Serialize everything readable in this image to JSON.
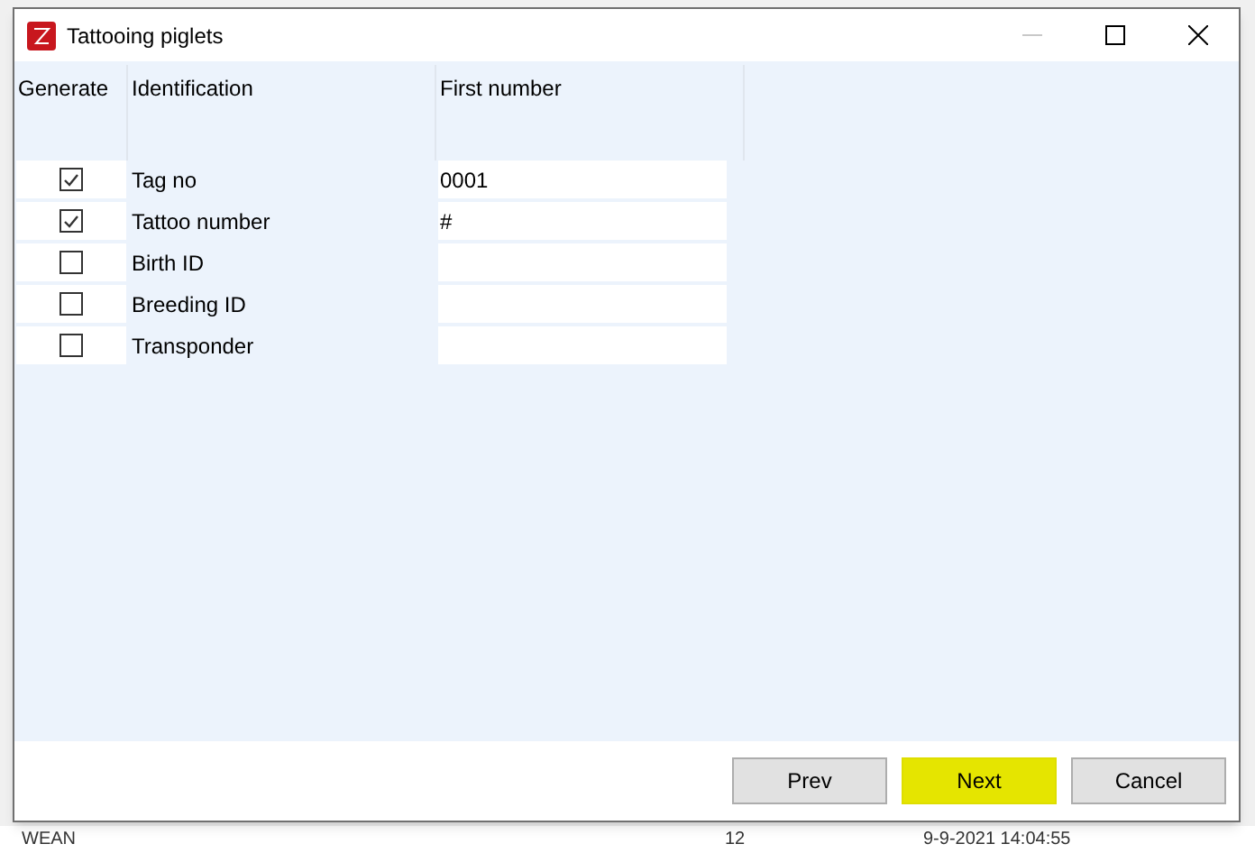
{
  "window": {
    "title": "Tattooing piglets",
    "controls": [
      {
        "kind": "minimize",
        "disabled": true
      },
      {
        "kind": "maximize",
        "disabled": false
      },
      {
        "kind": "close",
        "disabled": false
      }
    ]
  },
  "table": {
    "columns": [
      "Generate",
      "Identification",
      "First number"
    ],
    "rows": [
      {
        "checked": true,
        "identification": "Tag no",
        "first_number": "0001"
      },
      {
        "checked": true,
        "identification": "Tattoo number",
        "first_number": "#"
      },
      {
        "checked": false,
        "identification": "Birth ID",
        "first_number": ""
      },
      {
        "checked": false,
        "identification": "Breeding ID",
        "first_number": ""
      },
      {
        "checked": false,
        "identification": "Transponder",
        "first_number": ""
      }
    ]
  },
  "buttons": [
    {
      "label": "Prev",
      "highlighted": false
    },
    {
      "label": "Next",
      "highlighted": true
    },
    {
      "label": "Cancel",
      "highlighted": false
    }
  ],
  "background_row": [
    "WEAN",
    "12",
    "9-9-2021 14:04:55"
  ]
}
